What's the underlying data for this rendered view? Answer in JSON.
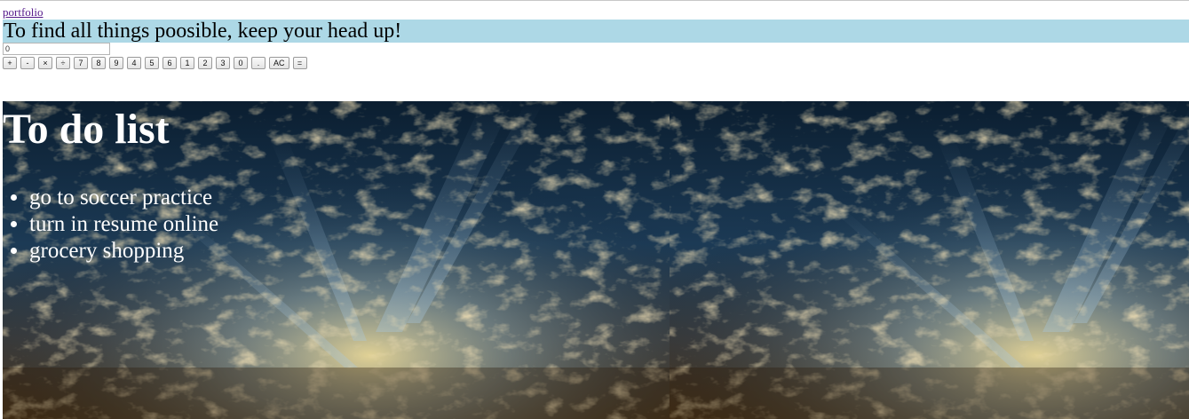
{
  "nav": {
    "portfolio_link": "portfolio"
  },
  "banner": {
    "text": "To find all things poosible, keep your head up!",
    "background_color": "#add8e6"
  },
  "calculator": {
    "display_value": "0",
    "keys": [
      "+",
      "-",
      "×",
      "÷",
      "7",
      "8",
      "9",
      "4",
      "5",
      "6",
      "1",
      "2",
      "3",
      "0",
      ".",
      "AC",
      "="
    ]
  },
  "todo": {
    "title": "To do list",
    "items": [
      "go to soccer practice",
      "turn in resume online",
      "grocery shopping"
    ],
    "background_image": "sunrays-through-clouds-image"
  }
}
